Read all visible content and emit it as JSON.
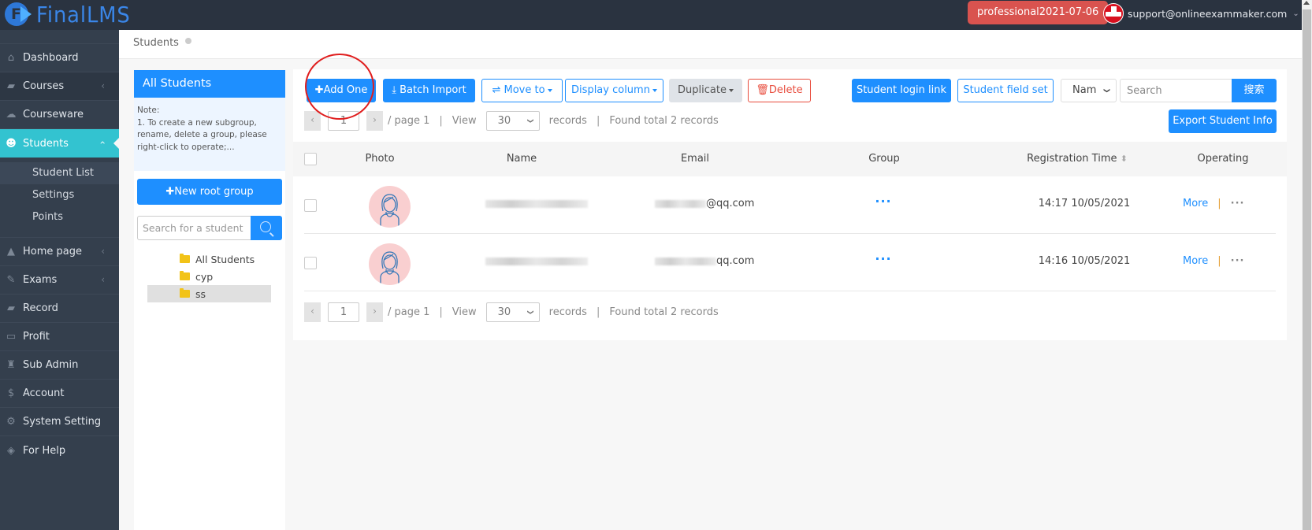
{
  "header": {
    "brand": "FinalLMS",
    "brand_letter": "F",
    "version_badge": "professional2021-07-06",
    "user_email": "support@onlineexammaker.com",
    "user_caret": "⌄"
  },
  "sidebar": {
    "items": [
      {
        "label": "Dashboard",
        "icon": "home-icon",
        "glyph": "⌂",
        "has_chevron": false
      },
      {
        "label": "Courses",
        "icon": "book-icon",
        "glyph": "▰",
        "has_chevron": true
      },
      {
        "label": "Courseware",
        "icon": "cloud-upload-icon",
        "glyph": "☁",
        "has_chevron": false
      },
      {
        "label": "Students",
        "icon": "users-icon",
        "glyph": "👥",
        "has_chevron": true,
        "active": true
      },
      {
        "label": "Home page",
        "icon": "graduation-cap-icon",
        "glyph": "🎓",
        "has_chevron": true
      },
      {
        "label": "Exams",
        "icon": "puzzle-icon",
        "glyph": "✎",
        "has_chevron": true
      },
      {
        "label": "Record",
        "icon": "book-icon",
        "glyph": "▰",
        "has_chevron": false
      },
      {
        "label": "Profit",
        "icon": "credit-card-icon",
        "glyph": "▭",
        "has_chevron": false
      },
      {
        "label": "Sub Admin",
        "icon": "admin-icon",
        "glyph": "♜",
        "has_chevron": false
      },
      {
        "label": "Account",
        "icon": "dollar-icon",
        "glyph": "$",
        "has_chevron": false
      },
      {
        "label": "System Setting",
        "icon": "gear-icon",
        "glyph": "⚙",
        "has_chevron": false
      },
      {
        "label": "For Help",
        "icon": "ticket-icon",
        "glyph": "◈",
        "has_chevron": false
      }
    ],
    "chevron_glyph": "‹",
    "students_submenu": [
      {
        "label": "Student List",
        "current": true
      },
      {
        "label": "Settings"
      },
      {
        "label": "Points"
      }
    ]
  },
  "breadcrumb": {
    "current": "Students"
  },
  "group_panel": {
    "title": "All Students",
    "note_title": "Note:",
    "note_body": "1. To create a new subgroup, rename, delete a group, please right-click to operate;...",
    "new_root_label": "New root group",
    "search_placeholder": "Search for a student group",
    "groups": [
      {
        "name": "All Students",
        "selected": false
      },
      {
        "name": "cyp",
        "selected": false
      },
      {
        "name": "ss",
        "selected": true
      }
    ]
  },
  "toolbar": {
    "add_one": "Add One",
    "batch_import": "Batch Import",
    "move_to": "Move to",
    "display_column": "Display column",
    "duplicate": "Duplicate",
    "delete": "Delete",
    "student_login_link": "Student login link",
    "student_field_set": "Student field set",
    "search_field_selected": "Nam",
    "search_placeholder": "Search",
    "search_button": "搜索",
    "export": "Export Student Info"
  },
  "pagination": {
    "prev": "‹",
    "next": "›",
    "current_page": "1",
    "page_label": "/ page 1",
    "view_label": "View",
    "page_size": "30",
    "records_label": "records",
    "found_label": "Found total 2 records",
    "separator": "|"
  },
  "table": {
    "columns": [
      "Photo",
      "Name",
      "Email",
      "Group",
      "Registration Time",
      "Operating"
    ],
    "sort_glyph": "⬍",
    "rows": [
      {
        "name_visible": "",
        "email_suffix": "@qq.com",
        "group": "···",
        "registration_time": "14:17 10/05/2021",
        "more": "More",
        "op_more": "···"
      },
      {
        "name_visible": "",
        "email_suffix": "qq.com",
        "group": "···",
        "registration_time": "14:16 10/05/2021",
        "more": "More",
        "op_more": "···"
      }
    ]
  },
  "colors": {
    "primary": "#1e8fff",
    "sidebar_bg": "#343f4d",
    "topbar_bg": "#2a3340",
    "active_nav": "#33c3d0",
    "badge": "#d9534f",
    "danger": "#e84c3d",
    "annotation_circle": "#e01e1e"
  }
}
